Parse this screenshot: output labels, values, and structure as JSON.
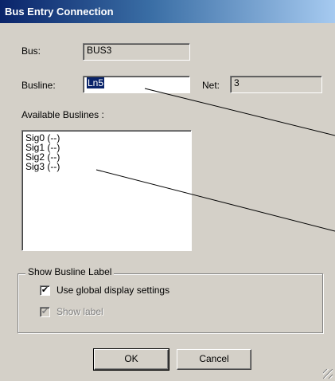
{
  "window": {
    "title": "Bus Entry Connection"
  },
  "fields": {
    "bus_label": "Bus:",
    "bus_value": "BUS3",
    "busline_label": "Busline:",
    "busline_value": "Ln5",
    "net_label": "Net:",
    "net_value": "3"
  },
  "available": {
    "label": "Available Buslines :",
    "items": [
      "Sig0 (--)",
      "Sig1 (--)",
      "Sig2 (--)",
      "Sig3 (--)"
    ]
  },
  "show_label_group": {
    "title": "Show Busline Label",
    "use_global": {
      "label": "Use global display settings",
      "checked": true
    },
    "show_label": {
      "label": "Show label",
      "checked": true,
      "disabled": true
    }
  },
  "buttons": {
    "ok": "OK",
    "cancel": "Cancel"
  },
  "colors": {
    "title_start": "#0a246a",
    "title_end": "#a6caf0",
    "dialog_bg": "#d4d0c8"
  }
}
